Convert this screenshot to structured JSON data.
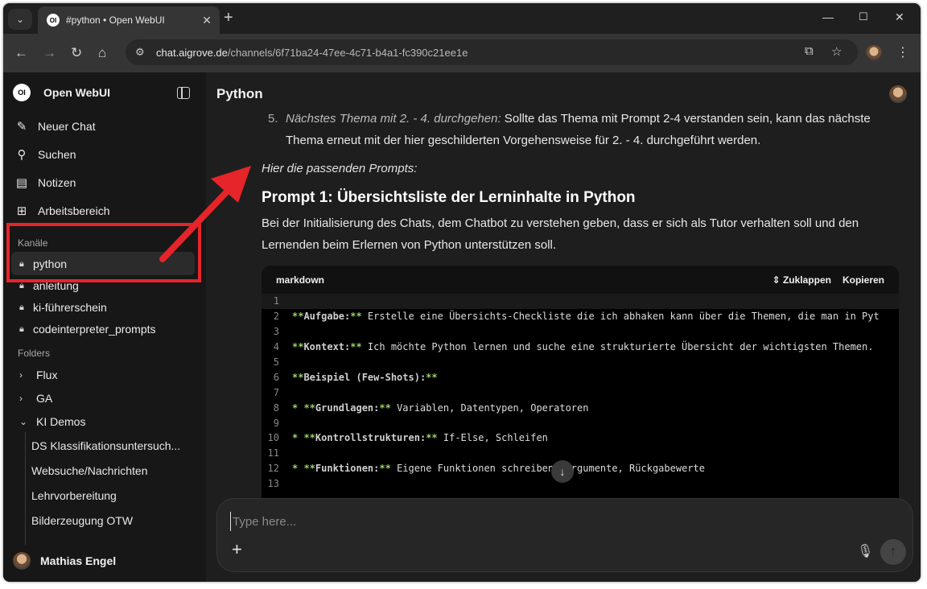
{
  "browser": {
    "tab_title": "#python • Open WebUI",
    "favicon_text": "OI",
    "url_host": "chat.aigrove.de",
    "url_path": "/channels/6f71ba24-47ee-4c71-b4a1-fc390c21ee1e"
  },
  "sidebar": {
    "brand": "Open WebUI",
    "brand_logo": "OI",
    "nav": [
      {
        "label": "Neuer Chat",
        "icon": "pencil-icon"
      },
      {
        "label": "Suchen",
        "icon": "search-icon"
      },
      {
        "label": "Notizen",
        "icon": "note-icon"
      },
      {
        "label": "Arbeitsbereich",
        "icon": "workspace-icon"
      }
    ],
    "channels_label": "Kanäle",
    "channels": [
      "python",
      "anleitung",
      "ki-führerschein",
      "codeinterpreter_prompts"
    ],
    "folders_label": "Folders",
    "folders": [
      {
        "label": "Flux",
        "expanded": false
      },
      {
        "label": "GA",
        "expanded": false
      },
      {
        "label": "KI Demos",
        "expanded": true
      }
    ],
    "folder_chats": [
      "DS Klassifikationsuntersuch...",
      "Websuche/Nachrichten",
      "Lehrvorbereitung",
      "Bilderzeugung OTW"
    ],
    "user_name": "Mathias Engel"
  },
  "main": {
    "title": "Python",
    "step_number": "5.",
    "step_em": "Nächstes Thema mit 2. - 4. durchgehen:",
    "step_text": " Sollte das Thema mit Prompt 2-4 verstanden sein, kann das nächste Thema erneut mit der hier geschilderten Vorgehensweise für 2. - 4. durchgeführt werden.",
    "intro": "Hier die passenden Prompts:",
    "heading": "Prompt 1: Übersichtsliste der Lerninhalte in Python",
    "paragraph": "Bei der Initialisierung des Chats, dem Chatbot zu verstehen geben, dass er sich als Tutor verhalten soll und den Lernenden beim Erlernen von Python unterstützen soll.",
    "code": {
      "language": "markdown",
      "collapse_label": "Zuklappen",
      "copy_label": "Kopieren",
      "lines": [
        {
          "n": "1",
          "kw": "",
          "text": ""
        },
        {
          "n": "2",
          "kw": "**Aufgabe:**",
          "text": " Erstelle eine Übersichts-Checkliste die ich abhaken kann über die Themen, die man in Pyt"
        },
        {
          "n": "3",
          "kw": "",
          "text": ""
        },
        {
          "n": "4",
          "kw": "**Kontext:**",
          "text": " Ich möchte Python lernen und suche eine strukturierte Übersicht der wichtigsten Themen."
        },
        {
          "n": "5",
          "kw": "",
          "text": ""
        },
        {
          "n": "6",
          "kw": "**Beispiel (Few-Shots):**",
          "text": ""
        },
        {
          "n": "7",
          "kw": "",
          "text": ""
        },
        {
          "n": "8",
          "kw": "*   **Grundlagen:**",
          "text": " Variablen, Datentypen, Operatoren"
        },
        {
          "n": "9",
          "kw": "",
          "text": ""
        },
        {
          "n": "10",
          "kw": "*   **Kontrollstrukturen:**",
          "text": " If-Else, Schleifen"
        },
        {
          "n": "11",
          "kw": "",
          "text": ""
        },
        {
          "n": "12",
          "kw": "*   **Funktionen:**",
          "text": " Eigene Funktionen schreiben, Argumente, Rückgabewerte"
        },
        {
          "n": "13",
          "kw": "",
          "text": ""
        }
      ]
    },
    "composer_placeholder": "Type here..."
  },
  "colors": {
    "highlight": "#e5252a",
    "code_keyword": "#9ece6a"
  }
}
